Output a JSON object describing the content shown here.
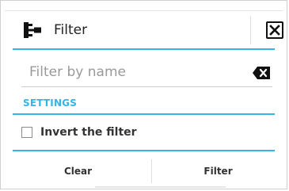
{
  "dialog": {
    "title": "Filter",
    "icon": "hierarchy-icon",
    "close_icon": "close-icon"
  },
  "search": {
    "placeholder": "Filter by name",
    "value": "",
    "clear_icon": "backspace-clear-icon"
  },
  "settings": {
    "section_label": "SETTINGS",
    "invert_label": "Invert the filter",
    "invert_checked": false
  },
  "footer": {
    "clear_label": "Clear",
    "filter_label": "Filter"
  },
  "colors": {
    "accent": "#33b5e5",
    "text": "#222222",
    "placeholder": "#9a9a9a"
  }
}
